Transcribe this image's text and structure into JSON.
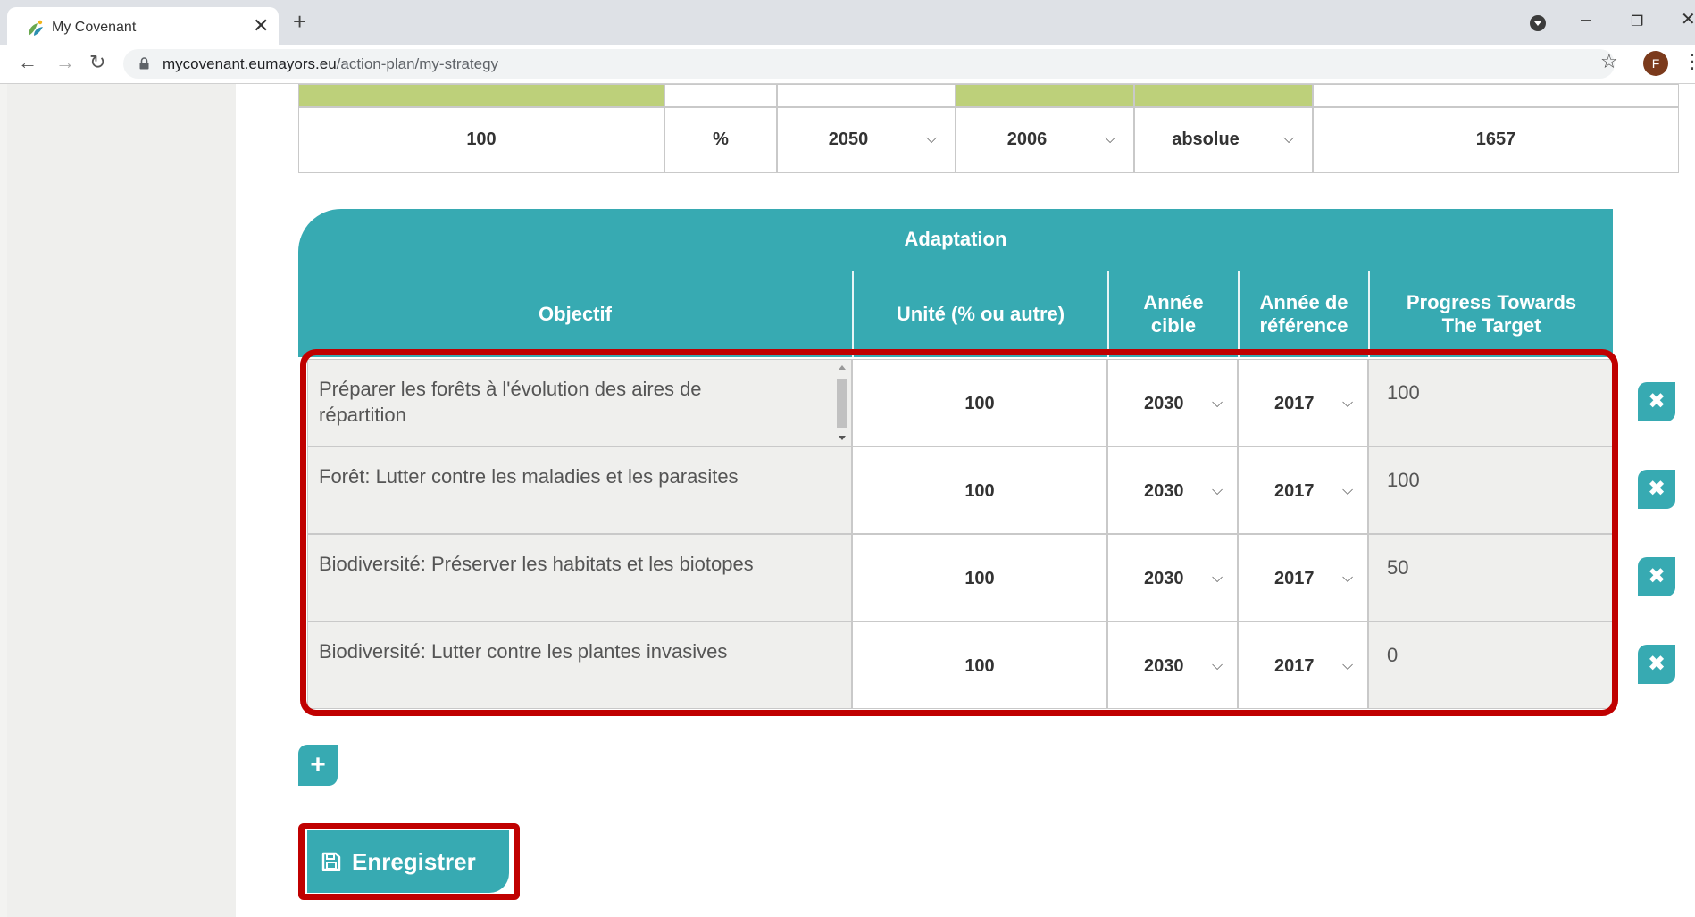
{
  "browser": {
    "tab_title": "My Covenant",
    "tab_close": "✕",
    "new_tab": "+",
    "url_host": "mycovenant.eumayors.eu",
    "url_path": "/action-plan/my-strategy",
    "profile_initial": "F"
  },
  "top_table": {
    "values": [
      "100",
      "%",
      "2050",
      "2006",
      "absolue",
      "1657"
    ]
  },
  "adaptation": {
    "title": "Adaptation",
    "headers": {
      "objective": "Objectif",
      "unit": "Unité (% ou autre)",
      "target_year_1": "Année",
      "target_year_2": "cible",
      "ref_year_1": "Année de",
      "ref_year_2": "référence",
      "progress_1": "Progress Towards",
      "progress_2": "The Target"
    },
    "rows": [
      {
        "objective_line1": "Préparer les forêts à l'évolution des aires de",
        "objective_line2": "répartition",
        "unit": "100",
        "target_year": "2030",
        "ref_year": "2017",
        "progress": "100"
      },
      {
        "objective_line1": "Forêt: Lutter contre les maladies et les parasites",
        "objective_line2": "",
        "unit": "100",
        "target_year": "2030",
        "ref_year": "2017",
        "progress": "100"
      },
      {
        "objective_line1": "Biodiversité: Préserver les habitats et les biotopes",
        "objective_line2": "",
        "unit": "100",
        "target_year": "2030",
        "ref_year": "2017",
        "progress": "50"
      },
      {
        "objective_line1": "Biodiversité: Lutter contre les plantes invasives",
        "objective_line2": "",
        "unit": "100",
        "target_year": "2030",
        "ref_year": "2017",
        "progress": "0"
      }
    ],
    "delete_icon": "✖",
    "add_icon": "+"
  },
  "actions": {
    "save_label": "Enregistrer"
  },
  "colors": {
    "accent": "#37aab2",
    "highlight": "#c00000",
    "green_cell": "#bdd07a"
  }
}
